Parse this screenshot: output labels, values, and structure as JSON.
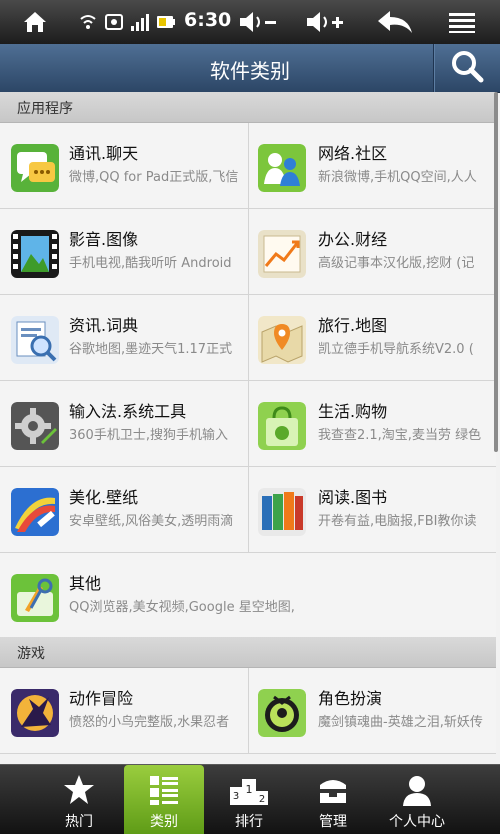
{
  "status_bar": {
    "time": "6:30"
  },
  "header": {
    "title": "软件类别"
  },
  "sections": [
    {
      "label": "应用程序"
    },
    {
      "label": "游戏"
    }
  ],
  "apps": [
    {
      "name": "通讯.聊天",
      "desc": "微博,QQ for Pad正式版,飞信"
    },
    {
      "name": "网络.社区",
      "desc": "新浪微博,手机QQ空间,人人"
    },
    {
      "name": "影音.图像",
      "desc": "手机电视,酷我听听 Android"
    },
    {
      "name": "办公.财经",
      "desc": "高级记事本汉化版,挖财 (记"
    },
    {
      "name": "资讯.词典",
      "desc": "谷歌地图,墨迹天气1.17正式"
    },
    {
      "name": "旅行.地图",
      "desc": "凯立德手机导航系统V2.0 ("
    },
    {
      "name": "输入法.系统工具",
      "desc": "360手机卫士,搜狗手机输入"
    },
    {
      "name": "生活.购物",
      "desc": "我查查2.1,淘宝,麦当劳 绿色"
    },
    {
      "name": "美化.壁纸",
      "desc": "安卓壁纸,风俗美女,透明雨滴"
    },
    {
      "name": "阅读.图书",
      "desc": "开卷有益,电脑报,FBI教你读"
    },
    {
      "name": "其他",
      "desc": "QQ浏览器,美女视频,Google 星空地图,"
    }
  ],
  "games": [
    {
      "name": "动作冒险",
      "desc": "愤怒的小鸟完整版,水果忍者"
    },
    {
      "name": "角色扮演",
      "desc": "魔剑镇魂曲-英雄之泪,斩妖传"
    }
  ],
  "nav": [
    {
      "label": "热门",
      "icon": "star-icon"
    },
    {
      "label": "类别",
      "icon": "category-list-icon",
      "active": true
    },
    {
      "label": "排行",
      "icon": "ranking-podium-icon"
    },
    {
      "label": "管理",
      "icon": "manage-box-icon"
    },
    {
      "label": "个人中心",
      "icon": "user-icon"
    }
  ],
  "colors": {
    "title_bar": "#3b5a80",
    "nav_active": "#7fb92b",
    "status_bar": "#222222"
  }
}
